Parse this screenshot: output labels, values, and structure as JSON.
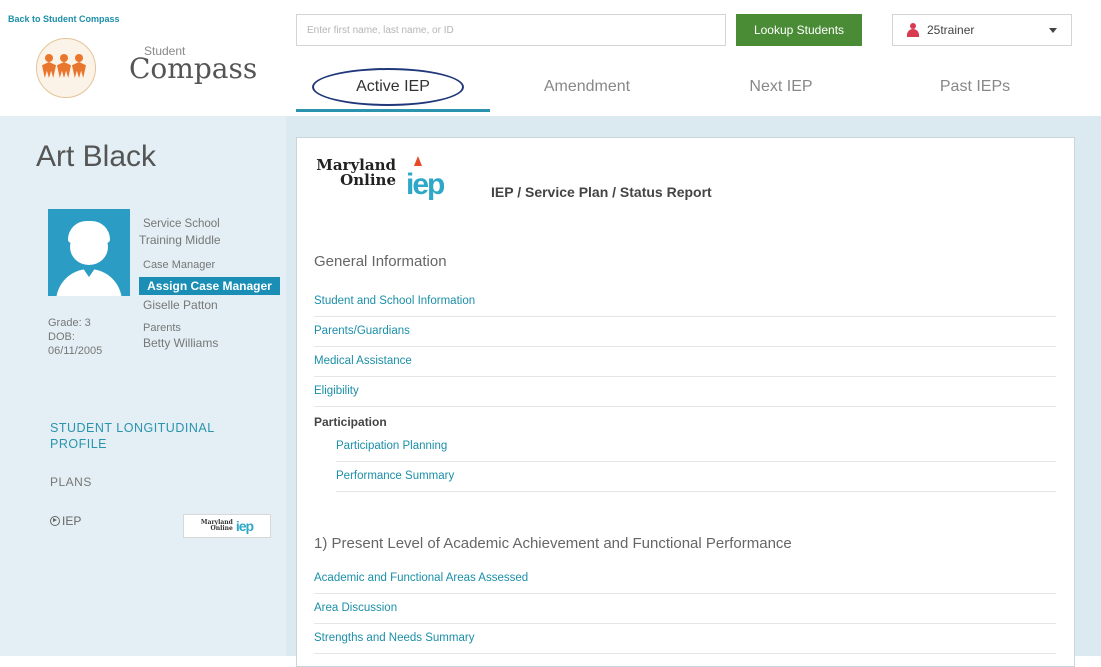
{
  "header": {
    "back_link": "Back to Student Compass",
    "logo_small": "Student",
    "logo_big": "Compass",
    "search_placeholder": "Enter first name, last name, or ID",
    "lookup_button": "Lookup Students",
    "username": "25trainer"
  },
  "tabs": [
    {
      "label": "Active IEP",
      "active": true
    },
    {
      "label": "Amendment",
      "active": false
    },
    {
      "label": "Next IEP",
      "active": false
    },
    {
      "label": "Past IEPs",
      "active": false
    }
  ],
  "student": {
    "name": "Art Black",
    "service_school_label": "Service School",
    "school_name": "Training Middle",
    "case_manager_label": "Case Manager",
    "assign_button": "Assign Case Manager",
    "case_manager_name": "Giselle Patton",
    "grade": "Grade: 3",
    "dob_label": "DOB:",
    "dob": "06/11/2005",
    "parents_label": "Parents",
    "parent_name": "Betty Williams"
  },
  "sidebar": {
    "longitudinal_link": "STUDENT LONGITUDINAL PROFILE",
    "plans_label": "PLANS",
    "iep_link": "IEP",
    "mini_logo_text_1": "Maryland",
    "mini_logo_text_2": "Online",
    "mini_logo_iep": "iep"
  },
  "panel": {
    "brand_line_1": "Maryland",
    "brand_line_2": "Online",
    "brand_iep": "iep",
    "title": "IEP / Service Plan / Status Report",
    "general_heading": "General Information",
    "general_links": [
      "Student and School Information",
      "Parents/Guardians",
      "Medical Assistance",
      "Eligibility"
    ],
    "participation_heading": "Participation",
    "participation_links": [
      "Participation Planning",
      "Performance Summary"
    ],
    "plaafp_heading": "1) Present Level of Academic Achievement and Functional Performance",
    "plaafp_links": [
      "Academic and Functional Areas Assessed",
      "Area Discussion",
      "Strengths and Needs Summary"
    ]
  },
  "colors": {
    "accent": "#2b93ad",
    "lookup_green": "#4a8b36",
    "assign_blue": "#1a8eb5",
    "logo_orange": "#e8762c",
    "oval_navy": "#20387a"
  }
}
